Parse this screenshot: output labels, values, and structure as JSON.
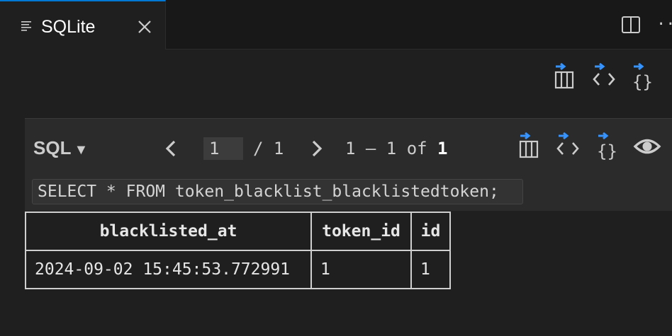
{
  "tab": {
    "title": "SQLite",
    "icon": "lines-icon",
    "close_icon": "close-icon"
  },
  "editor_actions": {
    "split_icon": "split-editor-icon",
    "more_icon": "more-actions-icon",
    "more_label": "··"
  },
  "toolbar_icons": [
    "export-csv-icon",
    "export-html-icon",
    "export-json-icon"
  ],
  "query_panel": {
    "language_menu": "SQL",
    "caret": "▼",
    "page_value": "1",
    "page_total": "/ 1",
    "range_prefix": "1 – 1 of ",
    "range_total": "1",
    "query": "SELECT * FROM token_blacklist_blacklistedtoken;",
    "icons": [
      "export-csv-icon",
      "export-html-icon",
      "export-json-icon",
      "eye-icon"
    ]
  },
  "results": {
    "columns": [
      "blacklisted_at",
      "token_id",
      "id"
    ],
    "rows": [
      [
        "2024-09-02 15:45:53.772991",
        "1",
        "1"
      ]
    ]
  },
  "colors": {
    "accent": "#0078d4",
    "icon_arrow": "#3794ff",
    "background": "#1f1f1f",
    "panel": "#2b2b2b"
  }
}
